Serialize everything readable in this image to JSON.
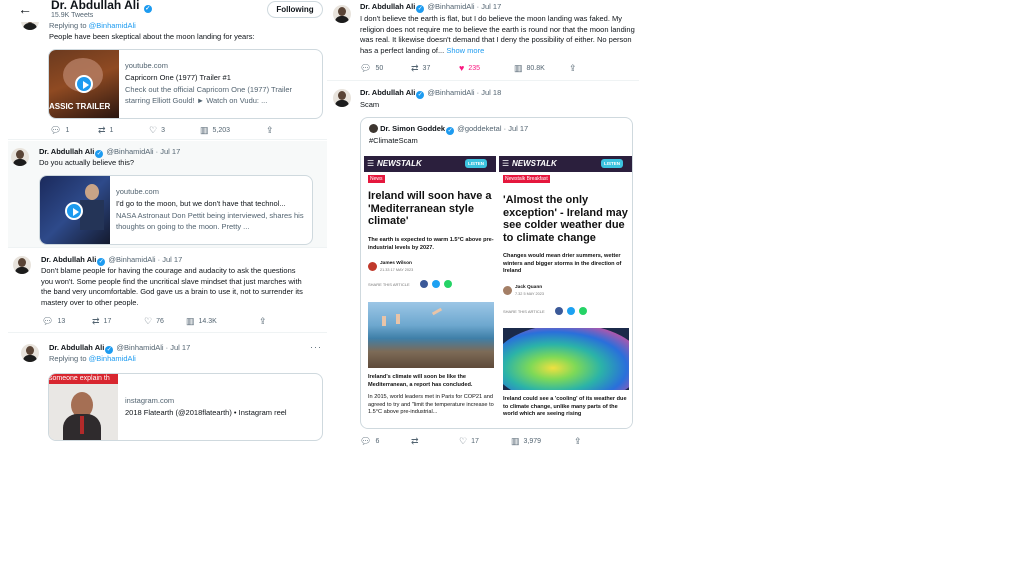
{
  "header": {
    "name": "Dr. Abdullah Ali",
    "tweet_count": "15.9K Tweets",
    "follow_label": "Following"
  },
  "left_tweets": {
    "t1": {
      "replying_prefix": "Replying to ",
      "replying_handle": "@BinhamidAli",
      "text": "People have been skeptical about the moon landing for years:",
      "card": {
        "domain": "youtube.com",
        "title": "Capricorn One (1977) Trailer #1",
        "desc": "Check out the official Capricorn One (1977) Trailer starring Elliott Gould! ► Watch on Vudu: ...",
        "thumb_text": "ASSIC TRAILER"
      },
      "stats": {
        "replies": "1",
        "retweets": "1",
        "likes": "3",
        "views": "5,203"
      }
    },
    "t2": {
      "name": "Dr. Abdullah Ali",
      "handle": "@BinhamidAli",
      "date": "Jul 17",
      "text": "Do you actually believe this?",
      "card": {
        "domain": "youtube.com",
        "title": "I'd go to the moon, but we don't have that technol...",
        "desc": "NASA Astronaut Don Pettit being interviewed, shares his thoughts on going to the moon. Pretty ..."
      }
    },
    "t3": {
      "name": "Dr. Abdullah Ali",
      "handle": "@BinhamidAli",
      "date": "Jul 17",
      "text": "Don't blame people for having the courage and audacity to ask the questions you won't. Some people find the uncritical slave mindset that just marches with the band very uncomfortable. God gave us a brain to use it, not to surrender its mastery over to other people.",
      "stats": {
        "replies": "13",
        "retweets": "17",
        "likes": "76",
        "views": "14.3K"
      }
    },
    "t4": {
      "name": "Dr. Abdullah Ali",
      "handle": "@BinhamidAli",
      "date": "Jul 17",
      "replying_prefix": "Replying to ",
      "replying_handle": "@BinhamidAli",
      "card": {
        "domain": "instagram.com",
        "title": "2018 Flatearth (@2018flatearth) • Instagram reel",
        "thumb_text": "someone explain th"
      }
    }
  },
  "right_tweets": {
    "r1": {
      "name": "Dr. Abdullah Ali",
      "handle": "@BinhamidAli",
      "date": "Jul 17",
      "text": "I don't believe the earth is flat, but I do believe the moon landing was faked. My religion does not require me to believe the earth is round nor that the moon landing was real. It likewise doesn't demand that I deny the possibility of either. No person has a perfect landing of... ",
      "show_more": "Show more",
      "stats": {
        "replies": "50",
        "retweets": "37",
        "likes": "235",
        "views": "80.8K"
      }
    },
    "r2": {
      "name": "Dr. Abdullah Ali",
      "handle": "@BinhamidAli",
      "date": "Jul 18",
      "text": "Scam",
      "quote": {
        "name": "Dr. Simon Goddek",
        "handle": "@goddeketal",
        "date": "Jul 17",
        "text": "#ClimateScam"
      },
      "stats": {
        "replies": "6",
        "retweets": "",
        "likes": "17",
        "views": "3,979"
      }
    }
  },
  "article1": {
    "logo": "NEWSTALK",
    "listen": "LISTEN",
    "tag": "News",
    "headline": "Ireland will soon have a 'Mediterranean style climate'",
    "sub": "The earth is expected to warm 1.5°C above pre-industrial levels by 2027.",
    "author": "James Wilson",
    "author_date": "21.33 17 MAY 2023",
    "share": "SHARE THIS ARTICLE",
    "caption": "Ireland's climate will soon be like the Mediterranean, a report has concluded.",
    "para": "In 2015, world leaders met in Paris for COP21 and agreed to try and \"limit the temperature increase to 1.5°C above pre-industrial..."
  },
  "article2": {
    "logo": "NEWSTALK",
    "listen": "LISTEN",
    "tag": "Newstalk Breakfast",
    "headline": "'Almost the only exception' - Ireland may see colder weather due to climate change",
    "sub": "Changes would mean drier summers, wetter winters and bigger storms in the direction of Ireland",
    "author": "Jack Quann",
    "author_date": "7.32 5 MAY 2023",
    "share": "SHARE THIS ARTICLE",
    "caption": "Ireland could see a 'cooling' of its weather due to climate change, unlike many parts of the world which are seeing rising"
  },
  "icons": {
    "back": "back-arrow-icon",
    "verified": "verified-badge-icon",
    "reply": "reply-icon",
    "retweet": "retweet-icon",
    "like": "heart-icon",
    "views": "views-icon",
    "share": "share-icon"
  },
  "colors": {
    "accent": "#1d9bf0",
    "like_active": "#f91880",
    "newstalk_bar": "#2b1f3d",
    "news_tag": "#e5173d"
  }
}
